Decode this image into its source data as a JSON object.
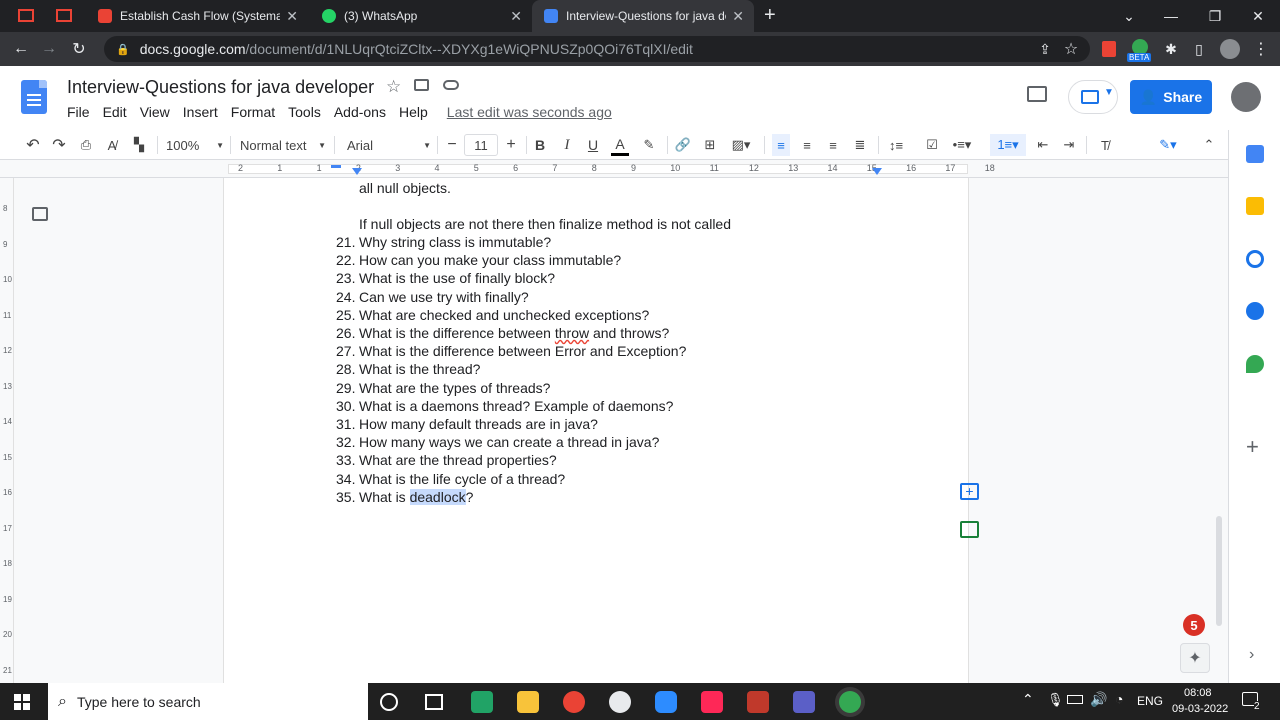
{
  "browser": {
    "tabs": [
      {
        "title": "Establish Cash Flow (Systematic P",
        "favicon_color": "#ea4335",
        "active": false
      },
      {
        "title": "(3) WhatsApp",
        "favicon_color": "#25d366",
        "active": false
      },
      {
        "title": "Interview-Questions for java deve",
        "favicon_color": "#4285f4",
        "active": true
      }
    ],
    "new_tab_glyph": "+",
    "url_host": "docs.google.com",
    "url_path": "/document/d/1NLUqrQtciZCltx--XDYXg1eWiQPNUSZp0QOi76TqlXI/edit",
    "profile_badge": "BETA"
  },
  "doc": {
    "title": "Interview-Questions for java developer",
    "menu": [
      "File",
      "Edit",
      "View",
      "Insert",
      "Format",
      "Tools",
      "Add-ons",
      "Help"
    ],
    "last_edit": "Last edit was seconds ago",
    "share_label": "Share"
  },
  "toolbar": {
    "zoom": "100%",
    "style": "Normal text",
    "font": "Arial",
    "font_size": "11",
    "bold": "B",
    "italic": "I",
    "underline": "U",
    "text_color": "A"
  },
  "ruler": {
    "ticks": [
      "2",
      "1",
      "1",
      "2",
      "3",
      "4",
      "5",
      "6",
      "7",
      "8",
      "9",
      "10",
      "11",
      "12",
      "13",
      "14",
      "15",
      "16",
      "17",
      "18"
    ],
    "vticks": [
      "8",
      "9",
      "10",
      "11",
      "12",
      "13",
      "14",
      "15",
      "16",
      "17",
      "18",
      "19",
      "20",
      "21"
    ]
  },
  "content": {
    "pre_lines": [
      "all null objects.",
      "If null objects are not there then finalize method is not called"
    ],
    "items": [
      {
        "n": "21.",
        "text": "Why string class is immutable?"
      },
      {
        "n": "22.",
        "text": "How can you make your class immutable?"
      },
      {
        "n": "23.",
        "text": "What is the use of finally block?"
      },
      {
        "n": "24.",
        "text": "Can we use try with finally?"
      },
      {
        "n": "25.",
        "text": "What are checked and unchecked exceptions?"
      },
      {
        "n": "26.",
        "text_a": "What is the difference between ",
        "text_b": "throw",
        "text_c": " and throws?"
      },
      {
        "n": "27.",
        "text": "What is the difference between Error and Exception?"
      },
      {
        "n": "28.",
        "text": "What is the thread?"
      },
      {
        "n": "29.",
        "text": "What are the types of threads?"
      },
      {
        "n": "30.",
        "text": "What is a daemons thread? Example of daemons?"
      },
      {
        "n": "31.",
        "text": "How many default threads are in java?"
      },
      {
        "n": "32.",
        "text": "How many ways we can create a thread in java?"
      },
      {
        "n": "33.",
        "text": "What are the thread properties?"
      },
      {
        "n": "34.",
        "text": "What is the life cycle of a thread?"
      },
      {
        "n": "35.",
        "text_a": "What is ",
        "text_b": "deadlock",
        "text_c": "?"
      }
    ]
  },
  "notification_count": "5",
  "taskbar": {
    "search_placeholder": "Type here to search",
    "lang": "ENG",
    "time": "08:08",
    "date": "09-03-2022",
    "notif": "2"
  }
}
